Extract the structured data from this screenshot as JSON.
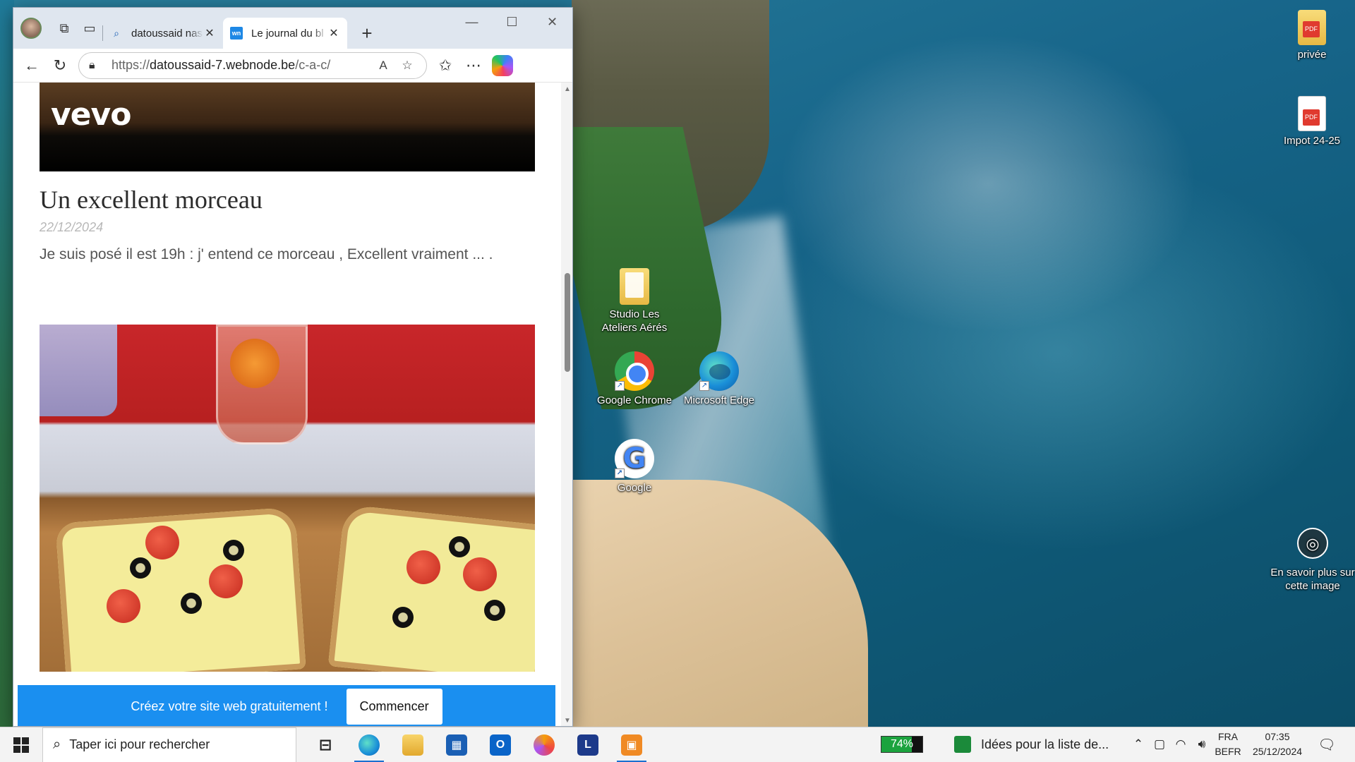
{
  "desktop": {
    "icons": [
      {
        "label": "privée"
      },
      {
        "label": "Impot 24-25"
      },
      {
        "label": "Studio Les Ateliers Aérés"
      },
      {
        "label": "Google Chrome"
      },
      {
        "label": "Microsoft Edge"
      },
      {
        "label": "Google"
      }
    ],
    "learn_more": "En savoir plus sur cette image"
  },
  "browser": {
    "tabs": [
      {
        "title": "datoussaid nasi",
        "favicon": "search-icon"
      },
      {
        "title": "Le journal du bl",
        "favicon": "webnode-icon"
      }
    ],
    "address": {
      "protocol": "https://",
      "domain": "datoussaid-7.webnode.be",
      "path": "/c-a-c/"
    },
    "page": {
      "video_brand": "vevo",
      "post_title": "Un excellent morceau",
      "post_date": "22/12/2024",
      "post_excerpt": "Je suis posé il est 19h : j' entend ce morceau , Excellent vraiment ... .",
      "cta_text": "Créez votre site web gratuitement !",
      "cta_button": "Commencer"
    }
  },
  "taskbar": {
    "search_placeholder": "Taper ici pour rechercher",
    "battery": {
      "value": 0.74,
      "label": "74%"
    },
    "notification": "Idées pour la liste de...",
    "language": {
      "lang": "FRA",
      "layout": "BEFR"
    },
    "clock": {
      "time": "07:35",
      "date": "25/12/2024"
    }
  },
  "colors": {
    "accent": "#1a8ff0",
    "taskbar_bg": "#f3f3f3",
    "battery_fill": "#1ba33e"
  }
}
